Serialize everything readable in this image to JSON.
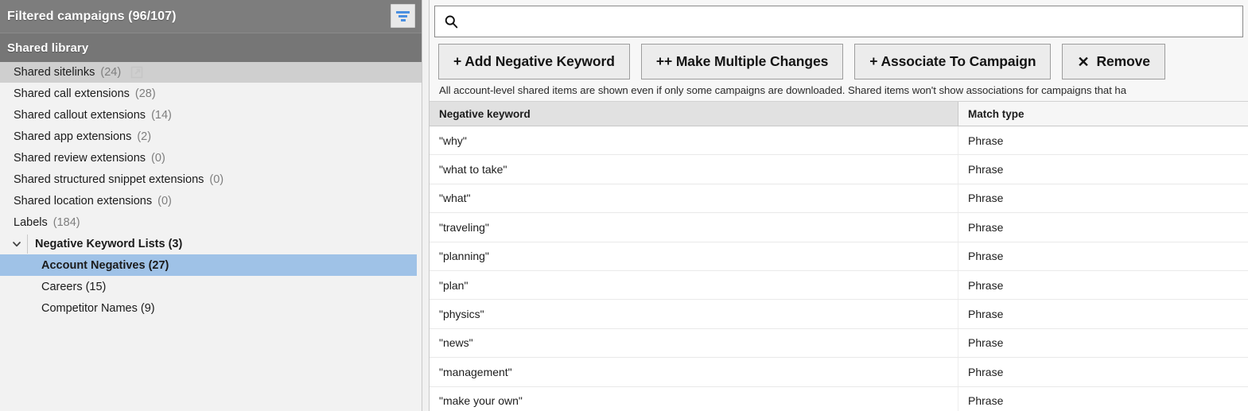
{
  "sidebar": {
    "header": {
      "title": "Filtered campaigns (96/107)",
      "filter_icon": "filter-funnel-icon"
    },
    "subheader": {
      "title": "Shared library"
    },
    "items": [
      {
        "label": "Shared sitelinks",
        "count": "(24)",
        "icon": "external-link-icon",
        "selected_row": true
      },
      {
        "label": "Shared call extensions",
        "count": "(28)"
      },
      {
        "label": "Shared callout extensions",
        "count": "(14)"
      },
      {
        "label": "Shared app extensions",
        "count": "(2)"
      },
      {
        "label": "Shared review extensions",
        "count": "(0)"
      },
      {
        "label": "Shared structured snippet extensions",
        "count": "(0)"
      },
      {
        "label": "Shared location extensions",
        "count": "(0)"
      },
      {
        "label": "Labels",
        "count": "(184)"
      }
    ],
    "group": {
      "label": "Negative Keyword Lists (3)",
      "chevron_icon": "chevron-down-icon",
      "children": [
        {
          "label": "Account Negatives (27)",
          "selected": true
        },
        {
          "label": "Careers (15)",
          "selected": false
        },
        {
          "label": "Competitor Names (9)",
          "selected": false
        }
      ]
    }
  },
  "main": {
    "search": {
      "value": "",
      "placeholder": "",
      "icon": "search-icon"
    },
    "toolbar": [
      {
        "label": "+ Add Negative Keyword",
        "name": "add-negative-keyword-button"
      },
      {
        "label": "++ Make Multiple Changes",
        "name": "make-multiple-changes-button"
      },
      {
        "label": "+ Associate To Campaign",
        "name": "associate-to-campaign-button"
      },
      {
        "label": "Remove",
        "glyph": "✕",
        "name": "remove-button"
      }
    ],
    "notice": "All account-level shared items are shown even if only some campaigns are downloaded. Shared items won't show associations for campaigns that ha",
    "table": {
      "columns": [
        "Negative keyword",
        "Match type"
      ],
      "rows": [
        [
          "\"why\"",
          "Phrase"
        ],
        [
          "\"what to take\"",
          "Phrase"
        ],
        [
          "\"what\"",
          "Phrase"
        ],
        [
          "\"traveling\"",
          "Phrase"
        ],
        [
          "\"planning\"",
          "Phrase"
        ],
        [
          "\"plan\"",
          "Phrase"
        ],
        [
          "\"physics\"",
          "Phrase"
        ],
        [
          "\"news\"",
          "Phrase"
        ],
        [
          "\"management\"",
          "Phrase"
        ],
        [
          "\"make your own\"",
          "Phrase"
        ]
      ]
    }
  },
  "colors": {
    "header_gray": "#7d7d7d",
    "subheader_gray": "#767676",
    "selection_blue": "#9fc2e7",
    "filter_icon_blue": "#4a8fe0",
    "sidebar_bg": "#f2f2f2"
  }
}
